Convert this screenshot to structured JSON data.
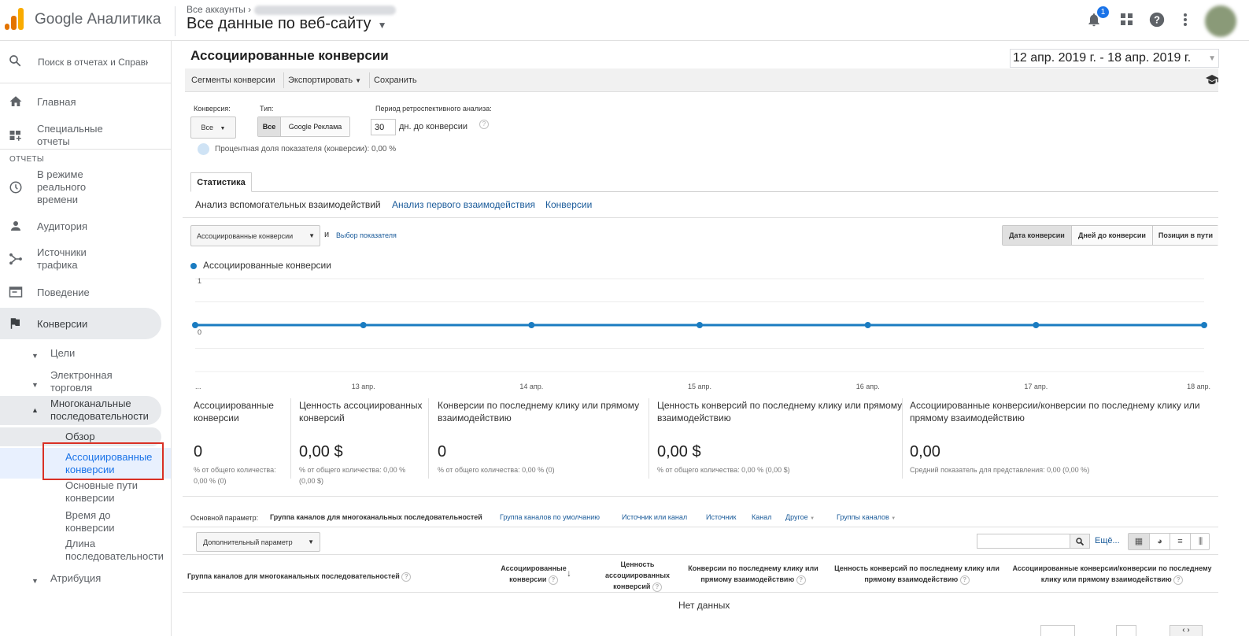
{
  "header": {
    "product": "Google Аналитика",
    "breadcrumb": "Все аккаунты",
    "view": "Все данные по веб-сайту",
    "notifications_count": "1",
    "icons": [
      "bell-icon",
      "apps-grid-icon",
      "help-icon",
      "more-vert-icon"
    ]
  },
  "sidebar": {
    "search_placeholder": "Поиск в отчетах и Справке",
    "home": "Главная",
    "custom_reports": "Специальные отчеты",
    "reports_header": "ОТЧЕТЫ",
    "realtime": "В режиме реального времени",
    "audience": "Аудитория",
    "acquisition": "Источники трафика",
    "behavior": "Поведение",
    "conversions": "Конверсии",
    "goals": "Цели",
    "ecommerce": "Электронная торговля",
    "mcf": "Многоканальные последовательности",
    "mcf_overview": "Обзор",
    "mcf_assisted": "Ассоциированные конверсии",
    "mcf_top_paths": "Основные пути конверсии",
    "mcf_time_lag": "Время до конверсии",
    "mcf_path_length": "Длина последовательности",
    "attribution": "Атрибуция"
  },
  "report": {
    "title": "Ассоциированные конверсии",
    "date_range": "12 апр. 2019 г. - 18 апр. 2019 г."
  },
  "toolbar": {
    "segments": "Сегменты конверсии",
    "export": "Экспортировать",
    "save": "Сохранить"
  },
  "controls": {
    "conversion_label": "Конверсия:",
    "conversion_value": "Все",
    "type_label": "Тип:",
    "type_all": "Все",
    "type_google_ads": "Google Реклама",
    "lookback_label": "Период ретроспективного анализа:",
    "lookback_value": "30",
    "lookback_suffix": "дн. до конверсии",
    "percent_text": "Процентная доля показателя (конверсии): 0,00 %"
  },
  "tabs": {
    "stats": "Статистика",
    "subtabs": [
      "Анализ вспомогательных взаимодействий",
      "Анализ первого взаимодействия",
      "Конверсии"
    ]
  },
  "chart_controls": {
    "metric": "Ассоциированные конверсии",
    "and": "и",
    "choose_metric": "Выбор показателя",
    "x_modes": [
      "Дата конверсии",
      "Дней до конверсии",
      "Позиция в пути"
    ]
  },
  "chart_data": {
    "type": "line",
    "series": [
      {
        "name": "Ассоциированные конверсии",
        "values": [
          0,
          0,
          0,
          0,
          0,
          0,
          0
        ]
      }
    ],
    "x": [
      "...",
      "13 апр.",
      "14 апр.",
      "15 апр.",
      "16 апр.",
      "17 апр.",
      "18 апр."
    ],
    "yticks": [
      "1",
      "0"
    ],
    "ylim": [
      -1,
      1
    ],
    "color": "#1a7cc1"
  },
  "scorecards": [
    {
      "title": "Ассоциированные конверсии",
      "value": "0",
      "sub": "% от общего количества: 0,00 % (0)"
    },
    {
      "title": "Ценность ассоциированных конверсий",
      "value": "0,00 $",
      "sub": "% от общего количества: 0,00 % (0,00 $)"
    },
    {
      "title": "Конверсии по последнему клику или прямому взаимодействию",
      "value": "0",
      "sub": "% от общего количества: 0,00 % (0)"
    },
    {
      "title": "Ценность конверсий по последнему клику или прямому взаимодействию",
      "value": "0,00 $",
      "sub": "% от общего количества: 0,00 % (0,00 $)"
    },
    {
      "title": "Ассоциированные конверсии/конверсии по последнему клику или прямому взаимодействию",
      "value": "0,00",
      "sub": "Средний показатель для представления: 0,00 (0,00 %)"
    }
  ],
  "primary_dimension": {
    "label": "Основной параметр:",
    "options": [
      "Группа каналов для многоканальных последовательностей",
      "Группа каналов по умолчанию",
      "Источник или канал",
      "Источник",
      "Канал",
      "Другое",
      "Группы каналов"
    ]
  },
  "table": {
    "secondary_dimension": "Дополнительный параметр",
    "more": "Ещё...",
    "headers": [
      "Группа каналов для многоканальных последовательностей",
      "Ассоциированные конверсии",
      "Ценность ассоциированных конверсий",
      "Конверсии по последнему клику или прямому взаимодействию",
      "Ценность конверсий по последнему клику или прямому взаимодействию",
      "Ассоциированные конверсии/конверсии по последнему клику или прямому взаимодействию"
    ],
    "empty": "Нет данных"
  }
}
